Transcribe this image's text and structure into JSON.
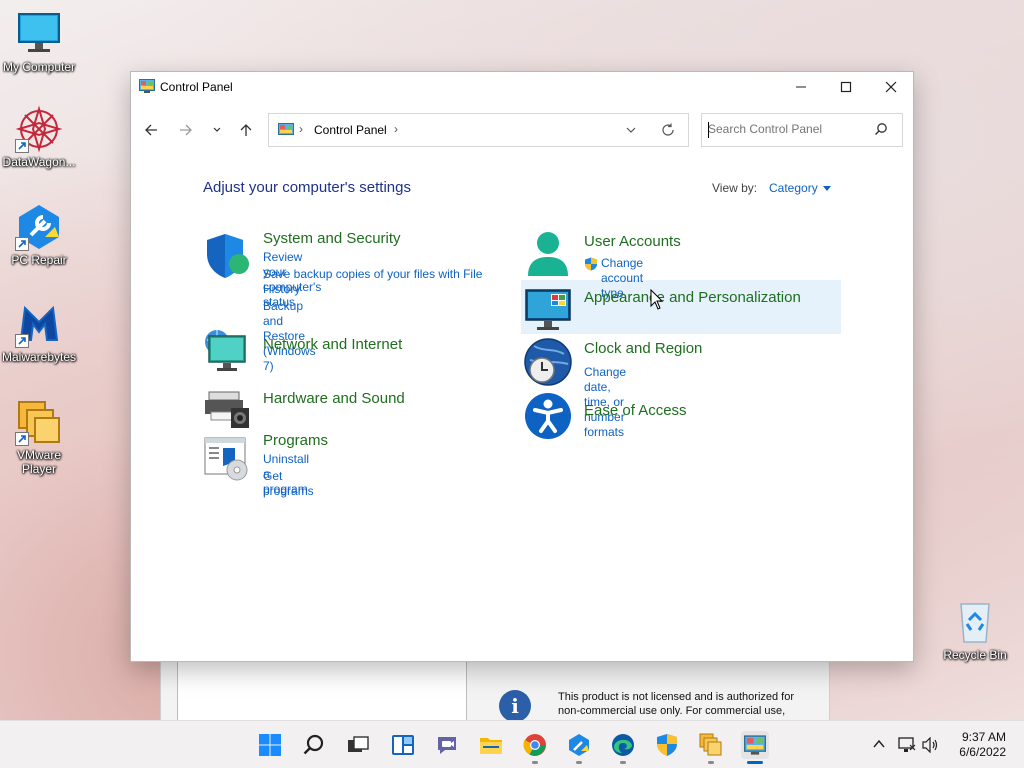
{
  "desktop": {
    "icons": [
      {
        "label": "My Computer"
      },
      {
        "label": "DataWagon..."
      },
      {
        "label": "PC Repair"
      },
      {
        "label": "Malwarebytes"
      },
      {
        "label": "VMware Player"
      },
      {
        "label": "Recycle Bin"
      }
    ]
  },
  "window": {
    "title": "Control Panel",
    "address": {
      "crumb": "Control Panel"
    },
    "search": {
      "placeholder": "Search Control Panel"
    },
    "heading": "Adjust your computer's settings",
    "view_by": {
      "label": "View by:",
      "value": "Category"
    },
    "categories_left": [
      {
        "title": "System and Security",
        "links": [
          "Review your computer's status",
          "Save backup copies of your files with File History",
          "Backup and Restore (Windows 7)"
        ]
      },
      {
        "title": "Network and Internet",
        "links": []
      },
      {
        "title": "Hardware and Sound",
        "links": []
      },
      {
        "title": "Programs",
        "links": [
          "Uninstall a program",
          "Get programs"
        ]
      }
    ],
    "categories_right": [
      {
        "title": "User Accounts",
        "links": [
          "Change account type"
        ]
      },
      {
        "title": "Appearance and Personalization",
        "links": []
      },
      {
        "title": "Clock and Region",
        "links": [
          "Change date, time, or number formats"
        ]
      },
      {
        "title": "Ease of Access",
        "links": []
      }
    ]
  },
  "background_window": {
    "notice": "This product is not licensed and is authorized for non-commercial use only. For commercial use,"
  },
  "taskbar": {
    "time": "9:37 AM",
    "date": "6/6/2022"
  }
}
